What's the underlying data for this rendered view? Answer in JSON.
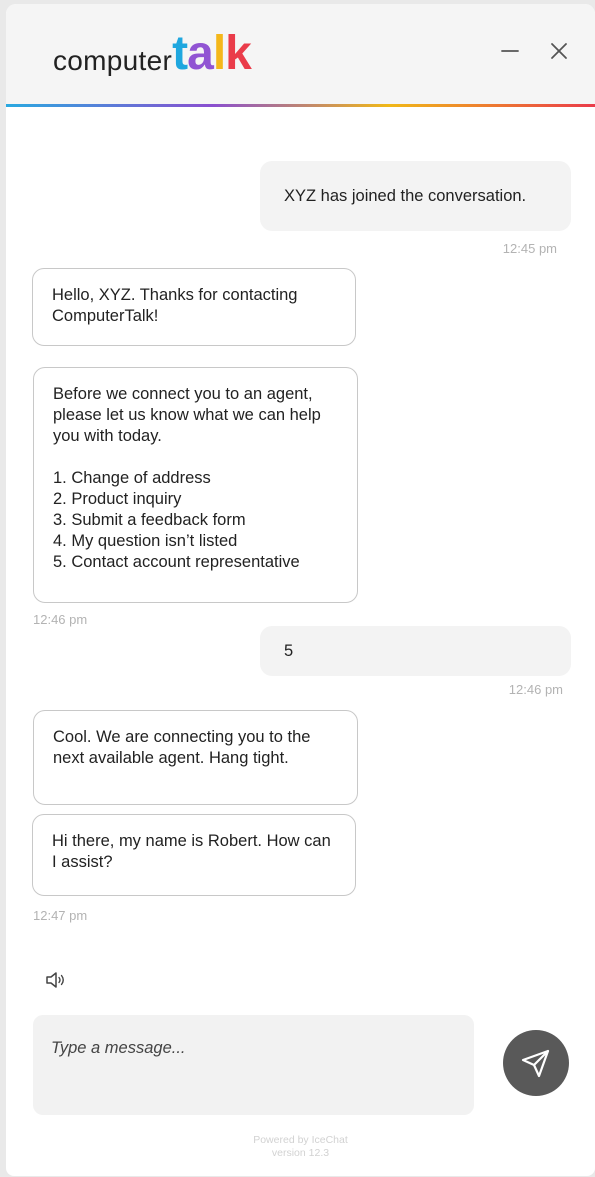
{
  "header": {
    "logo_light": "computer",
    "logo_bold": [
      "t",
      "a",
      "l",
      "k"
    ],
    "minimize_label": "Minimize",
    "close_label": "Close"
  },
  "colors": {
    "accent_blue": "#1fa7df",
    "accent_purple": "#9154d3",
    "accent_yellow": "#f4b71a",
    "accent_red": "#ea3c4a",
    "send_button": "#595959"
  },
  "messages": [
    {
      "sender": "user",
      "text": "XYZ has joined the conversation.",
      "time": "12:45 pm"
    },
    {
      "sender": "bot",
      "text": "Hello, XYZ. Thanks for contacting ComputerTalk!"
    },
    {
      "sender": "bot",
      "intro": "Before we connect you to an agent, please let us know what we can help you with today.",
      "options": [
        "1. Change of address",
        "2. Product inquiry",
        "3. Submit a feedback form",
        "4. My question isn’t listed",
        "5. Contact account representative"
      ],
      "time": "12:46 pm"
    },
    {
      "sender": "user",
      "text": "5",
      "time": "12:46 pm"
    },
    {
      "sender": "bot",
      "text": "Cool. We are connecting you to the next available agent. Hang tight."
    },
    {
      "sender": "bot",
      "text": "Hi there, my name is Robert. How can I assist?",
      "time": "12:47 pm"
    }
  ],
  "composer": {
    "placeholder": "Type a message...",
    "value": "",
    "speaker_icon": "speaker-icon",
    "send_icon": "paper-plane-icon"
  },
  "footer": {
    "powered_by": "Powered by IceChat",
    "version": "version 12.3"
  }
}
